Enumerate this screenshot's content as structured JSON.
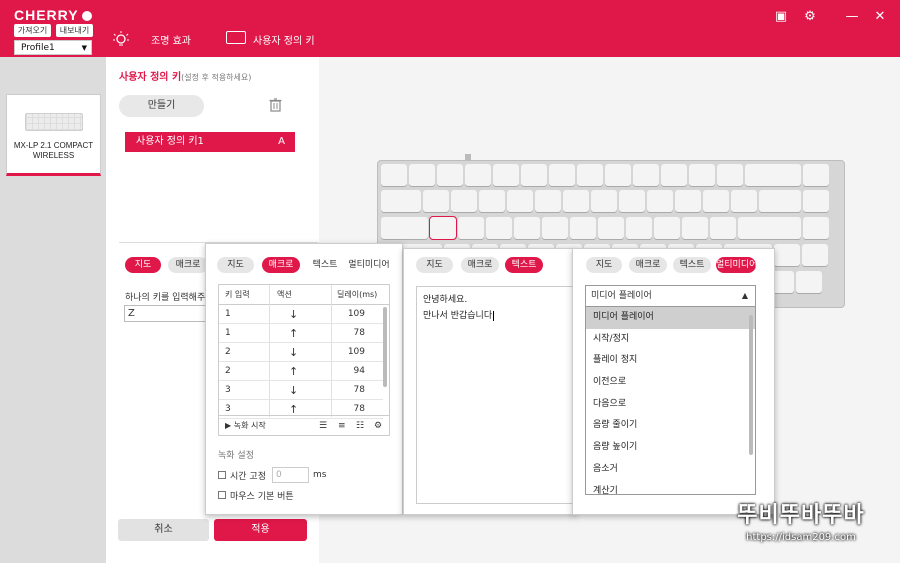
{
  "topbar": {
    "brand": "CHERRY",
    "import_label": "가져오기",
    "export_label": "내보내기",
    "profile": "Profile1",
    "nav_lighting": "조명 효과",
    "nav_userkey": "사용자 정의 키"
  },
  "device": {
    "name_line1": "MX-LP 2.1 COMPACT",
    "name_line2": "WIRELESS"
  },
  "userkey": {
    "title": "사용자 정의 키",
    "subtitle": "(설정 후 적용하세요)",
    "create_label": "만들기",
    "item_name": "사용자 정의 키1",
    "item_key": "A"
  },
  "tabs": {
    "map": "지도",
    "macro": "매크로",
    "text": "텍스트",
    "multimedia": "멀티미디어"
  },
  "left_panel": {
    "hint": "하나의 키를 입력해주",
    "key_value": "Z",
    "cancel": "취소",
    "apply": "적용"
  },
  "macro": {
    "headers": [
      "키 입력",
      "액션",
      "딜레이(ms)"
    ],
    "rows": [
      {
        "key": "1",
        "action": "↓",
        "delay": "109"
      },
      {
        "key": "1",
        "action": "↑",
        "delay": "78"
      },
      {
        "key": "2",
        "action": "↓",
        "delay": "109"
      },
      {
        "key": "2",
        "action": "↑",
        "delay": "94"
      },
      {
        "key": "3",
        "action": "↓",
        "delay": "78"
      },
      {
        "key": "3",
        "action": "↑",
        "delay": "78"
      }
    ],
    "record_label": "녹화 시작",
    "settings_title": "녹화 설정",
    "fixed_time": "시간 고정",
    "fixed_time_value": "0",
    "ms_unit": "ms",
    "mouse_default": "마우스 기본 버튼"
  },
  "text_panel": {
    "line1": "안녕하세요.",
    "line2": "만나서 반갑습니다"
  },
  "media": {
    "selected": "미디어 플레이어",
    "options": [
      "미디어 플레이어",
      "시작/정지",
      "플레이 정지",
      "이전으로",
      "다음으로",
      "음량 줄이기",
      "음량 높이기",
      "음소거",
      "계산기"
    ]
  },
  "watermark": {
    "main": "뚜비뚜바뚜바",
    "url": "https://idsam209.com"
  },
  "colors": {
    "accent": "#e0184a"
  }
}
